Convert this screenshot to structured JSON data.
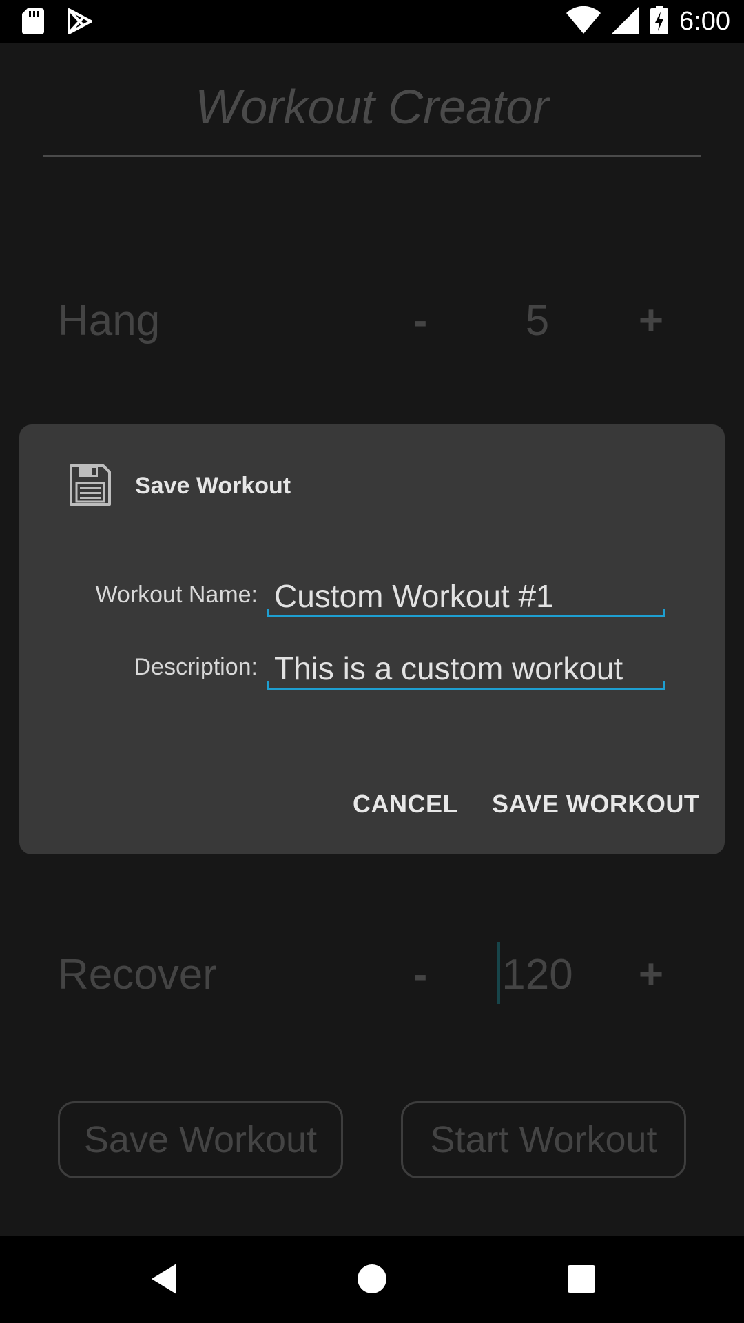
{
  "status_bar": {
    "time": "6:00",
    "icons": [
      "sd-card-icon",
      "play-store-icon",
      "wifi-icon",
      "signal-icon",
      "battery-charging-icon"
    ]
  },
  "app": {
    "title": "Workout Creator",
    "rows": [
      {
        "label": "Hang",
        "minus": "-",
        "value": "5",
        "plus": "+"
      },
      {
        "label": "Recover",
        "minus": "-",
        "value": "120",
        "plus": "+"
      }
    ],
    "buttons": {
      "save": "Save Workout",
      "start": "Start Workout"
    }
  },
  "dialog": {
    "title": "Save Workout",
    "icon": "floppy-disk-icon",
    "fields": {
      "name_label": "Workout Name:",
      "name_value": "Custom Workout #1",
      "description_label": "Description:",
      "description_value": "This is a custom workout"
    },
    "cancel_label": "CANCEL",
    "confirm_label": "SAVE WORKOUT",
    "accent_color": "#1e9fd1"
  },
  "nav_bar": {
    "icons": [
      "back-icon",
      "home-icon",
      "recents-icon"
    ]
  }
}
